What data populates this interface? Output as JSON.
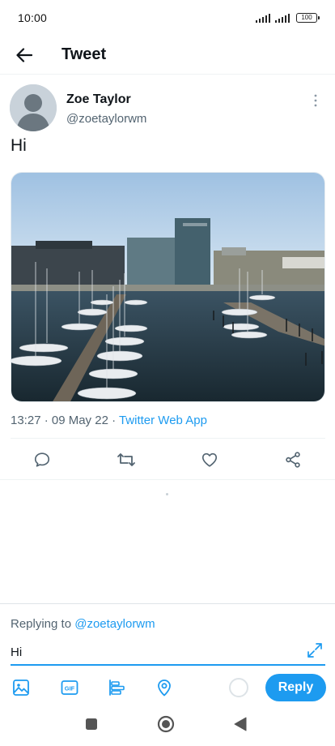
{
  "status_bar": {
    "time": "10:00",
    "battery": "100"
  },
  "header": {
    "title": "Tweet"
  },
  "tweet": {
    "author_name": "Zoe Taylor",
    "author_handle": "@zoetaylorwm",
    "text": "Hi",
    "timestamp": "13:27 · 09 May 22 · ",
    "source": "Twitter Web App"
  },
  "composer": {
    "replying_prefix": "Replying to ",
    "replying_handle": "@zoetaylorwm",
    "input_value": "Hi",
    "reply_label": "Reply"
  },
  "colors": {
    "accent": "#1d9bf0",
    "text_primary": "#0f1419",
    "text_secondary": "#536471"
  },
  "icons": {
    "back": "arrow-left-icon",
    "more": "more-vertical-icon",
    "reply": "comment-icon",
    "retweet": "retweet-icon",
    "like": "heart-icon",
    "share": "share-icon",
    "expand": "expand-icon",
    "image": "image-icon",
    "gif": "gif-icon",
    "poll": "poll-icon",
    "location": "location-icon"
  }
}
